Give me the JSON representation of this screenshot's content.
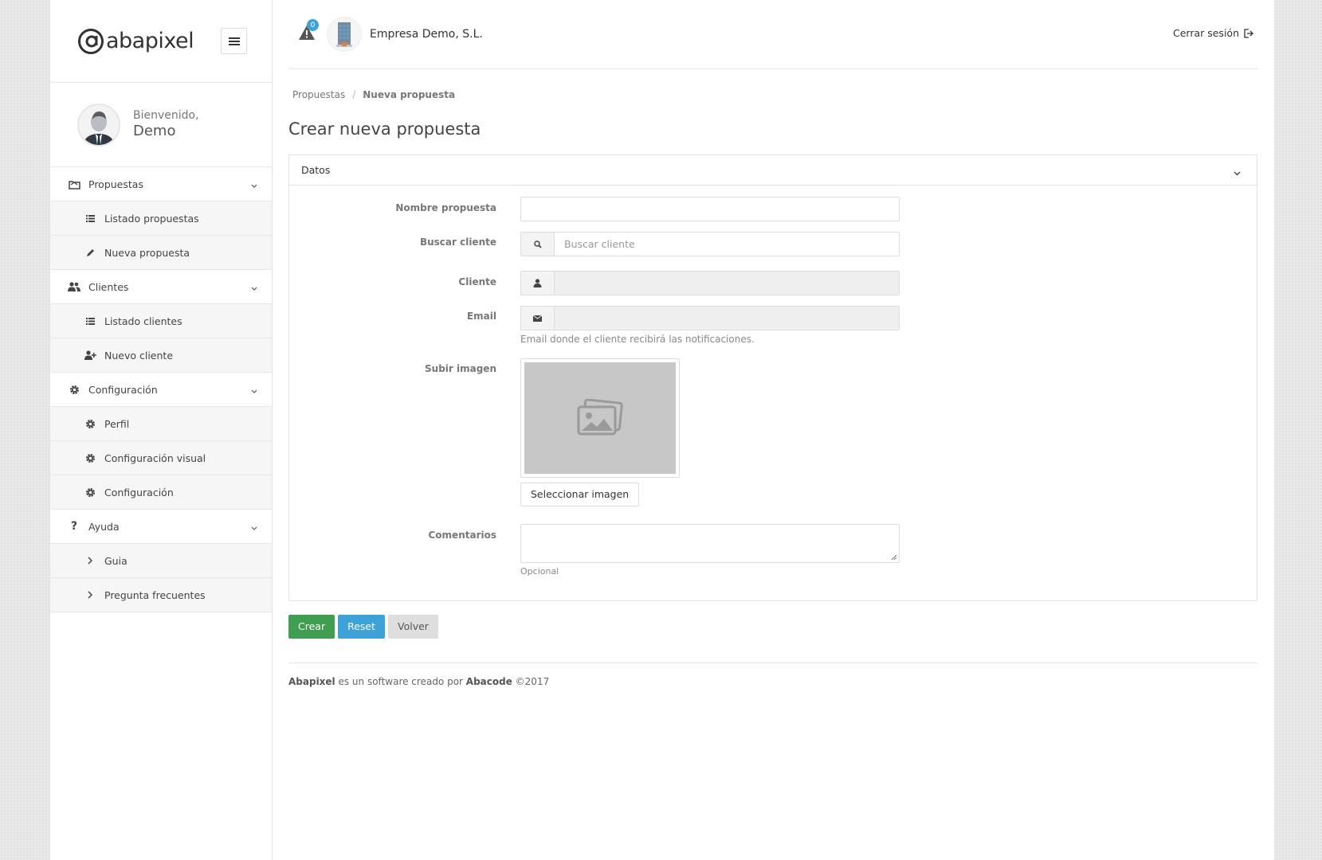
{
  "brand": {
    "logo_text": "abapixel"
  },
  "profile": {
    "welcome": "Bienvenido,",
    "name": "Demo"
  },
  "sidebar": {
    "sections": [
      {
        "label": "Propuestas",
        "icon": "folder-icon",
        "items": [
          {
            "label": "Listado propuestas",
            "icon": "list-icon"
          },
          {
            "label": "Nueva propuesta",
            "icon": "pencil-icon"
          }
        ]
      },
      {
        "label": "Clientes",
        "icon": "users-icon",
        "items": [
          {
            "label": "Listado clientes",
            "icon": "list-icon"
          },
          {
            "label": "Nuevo cliente",
            "icon": "user-plus-icon"
          }
        ]
      },
      {
        "label": "Configuración",
        "icon": "gear-icon",
        "items": [
          {
            "label": "Perfil",
            "icon": "gear-icon"
          },
          {
            "label": "Configuración visual",
            "icon": "gear-icon"
          },
          {
            "label": "Configuración",
            "icon": "gear-icon"
          }
        ]
      },
      {
        "label": "Ayuda",
        "icon": "question-icon",
        "items": [
          {
            "label": "Guia",
            "icon": "chevron-right-icon"
          },
          {
            "label": "Pregunta frecuentes",
            "icon": "chevron-right-icon"
          }
        ]
      }
    ]
  },
  "topbar": {
    "alert_count": "0",
    "company": "Empresa Demo, S.L.",
    "logout": "Cerrar sesión"
  },
  "breadcrumb": {
    "parent": "Propuestas",
    "sep": "/",
    "current": "Nueva propuesta"
  },
  "page": {
    "title": "Crear nueva propuesta"
  },
  "panel": {
    "title": "Datos"
  },
  "form": {
    "nombre": {
      "label": "Nombre propuesta",
      "value": ""
    },
    "buscar": {
      "label": "Buscar cliente",
      "placeholder": "Buscar cliente"
    },
    "cliente": {
      "label": "Cliente",
      "value": ""
    },
    "email": {
      "label": "Email",
      "value": "",
      "help": "Email donde el cliente recibirá las notificaciones."
    },
    "imagen": {
      "label": "Subir imagen",
      "button": "Seleccionar imagen"
    },
    "comentarios": {
      "label": "Comentarios",
      "help": "Opcional"
    }
  },
  "actions": {
    "create": "Crear",
    "reset": "Reset",
    "back": "Volver"
  },
  "footer": {
    "brand": "Abapixel",
    "text": " es un software creado por ",
    "company": "Abacode",
    "year": " ©2017"
  },
  "colors": {
    "accent_blue": "#3ca2d8",
    "green": "#3f9e4f",
    "grey_button": "#dedede"
  }
}
